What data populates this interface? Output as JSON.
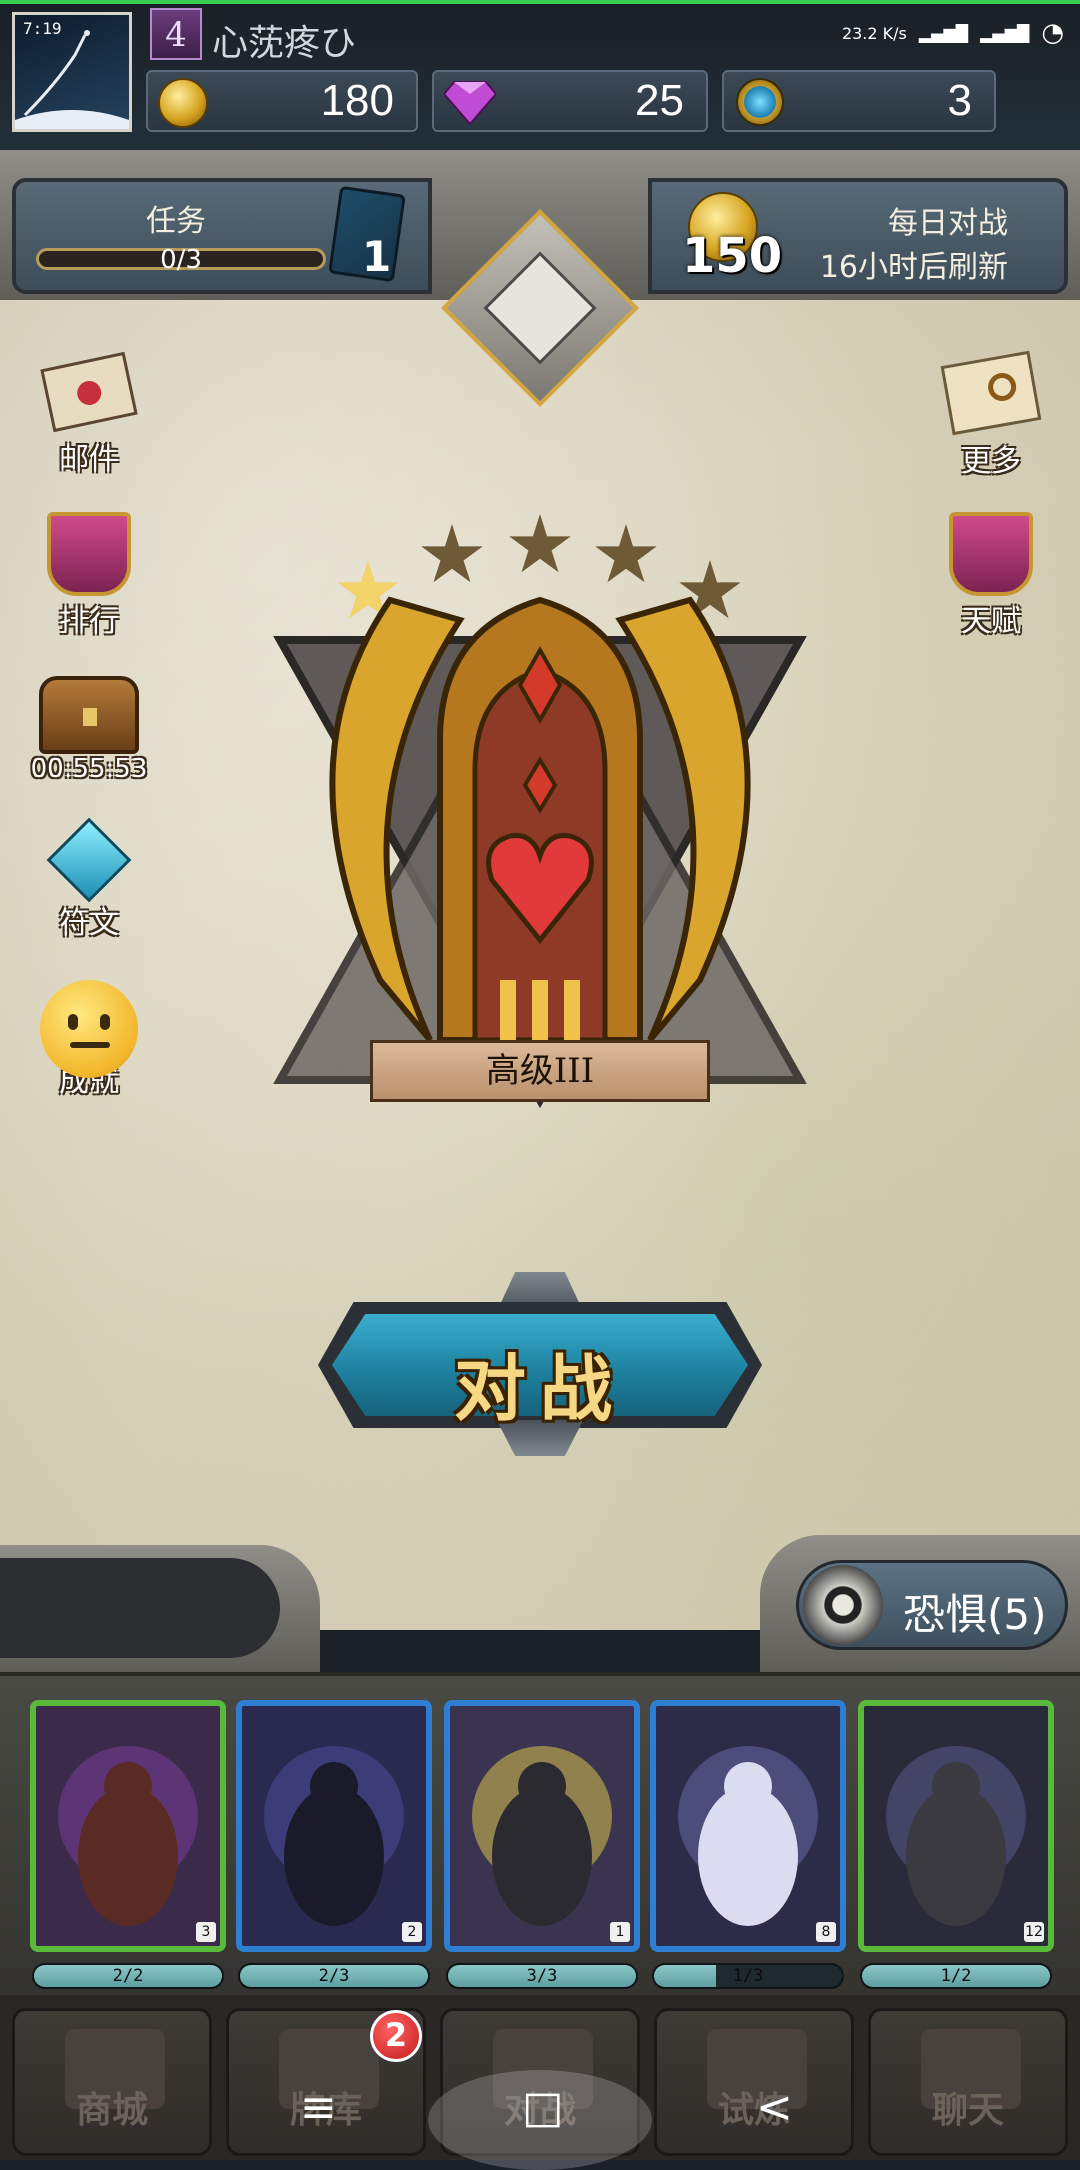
{
  "status": {
    "time": "7:19",
    "net_speed": "23.2 K/s",
    "net1": "4G",
    "net2": "4G+"
  },
  "player": {
    "level": "4",
    "name": "心莐疼ひ"
  },
  "resources": {
    "gold": "180",
    "gems": "25",
    "crystals": "3"
  },
  "task": {
    "title": "任务",
    "progress": "0/3",
    "book_count": "1"
  },
  "daily": {
    "title": "每日对战",
    "subtitle": "16小时后刷新",
    "reward": "150"
  },
  "side_left": {
    "mail": "邮件",
    "rank": "排行",
    "chest_timer": "00:55:53",
    "rune": "符文",
    "achieve": "成就"
  },
  "side_right": {
    "more": "更多",
    "talent": "天赋"
  },
  "rank": {
    "title": "高级III",
    "stars_filled": 1,
    "stars_total": 5
  },
  "battle": {
    "label": "对战"
  },
  "fear": {
    "label": "恐惧(5)"
  },
  "cards": [
    {
      "level": "3",
      "progress": "2/2",
      "fill": 1.0,
      "frame": "green"
    },
    {
      "level": "2",
      "progress": "2/3",
      "fill": 1.0,
      "frame": "blue"
    },
    {
      "level": "1",
      "progress": "3/3",
      "fill": 1.0,
      "frame": "blue"
    },
    {
      "level": "8",
      "progress": "1/3",
      "fill": 0.33,
      "frame": "blue"
    },
    {
      "level": "12",
      "progress": "1/2",
      "fill": 1.0,
      "frame": "green"
    }
  ],
  "nav": {
    "shop": "商城",
    "deck": "牌库",
    "deck_badge": "2",
    "battle": "对战",
    "trial": "试炼",
    "chat": "聊天"
  },
  "sysnav": {
    "menu": "≡",
    "home": "□",
    "back": "<"
  },
  "colors": {
    "accent_teal": "#1c7e9c",
    "gold": "#d7a521",
    "green_frame": "#58b93a",
    "blue_frame": "#2e7fd4"
  }
}
